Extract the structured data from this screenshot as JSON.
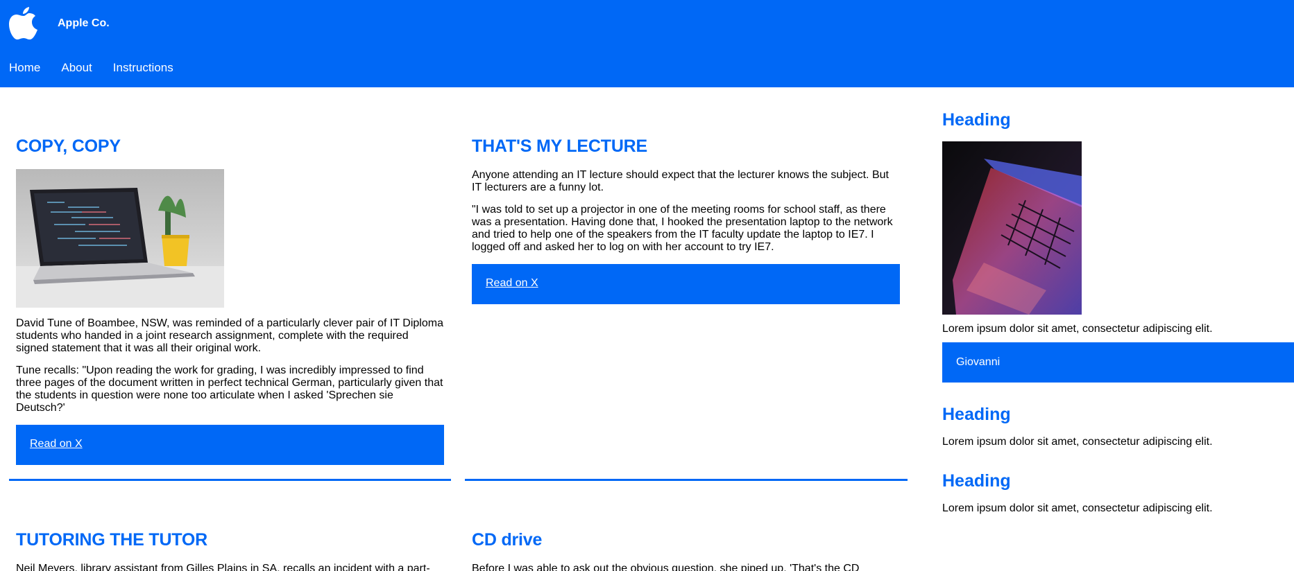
{
  "header": {
    "logo_icon": "apple-logo-icon",
    "brand": "Apple Co.",
    "nav": [
      "Home",
      "About",
      "Instructions"
    ],
    "accent": "#0068f6"
  },
  "articles": [
    {
      "title": "COPY, COPY",
      "image": "laptop-on-desk-image",
      "paragraphs": [
        "David Tune of Boambee, NSW, was reminded of a particularly clever pair of IT Diploma students who handed in a joint research assignment, complete with the required signed statement that it was all their original work.",
        "Tune recalls: \"Upon reading the work for grading, I was incredibly impressed to find three pages of the document written in perfect technical German, particularly given that the students in question were none too articulate when I asked 'Sprechen sie Deutsch?'"
      ],
      "link": "Read on X"
    },
    {
      "title": "THAT'S MY LECTURE",
      "paragraphs": [
        "Anyone attending an IT lecture should expect that the lecturer knows the subject. But IT lecturers are a funny lot.",
        "\"I was told to set up a projector in one of the meeting rooms for school staff, as there was a presentation. Having done that, I hooked the presentation laptop to the network and tried to help one of the speakers from the IT faculty update the laptop to IE7. I logged off and asked her to log on with her account to try IE7."
      ],
      "link": "Read on X"
    }
  ],
  "bottom_articles": [
    {
      "title": "TUTORING THE TUTOR",
      "text": "Neil Meyers, library assistant from Gilles Plains in SA, recalls an incident with a part-"
    },
    {
      "title": "CD drive",
      "text": "Before I was able to ask out the obvious question, she piped up, 'That's the CD"
    }
  ],
  "sidebar": {
    "block1": {
      "heading": "Heading",
      "image": "glowing-laptop-keyboard-image",
      "text": "Lorem ipsum dolor sit amet, consectetur adipiscing elit.",
      "button": "Giovanni"
    },
    "block2": {
      "heading": "Heading",
      "text": "Lorem ipsum dolor sit amet, consectetur adipiscing elit."
    },
    "block3": {
      "heading": "Heading",
      "text": "Lorem ipsum dolor sit amet, consectetur adipiscing elit."
    }
  }
}
